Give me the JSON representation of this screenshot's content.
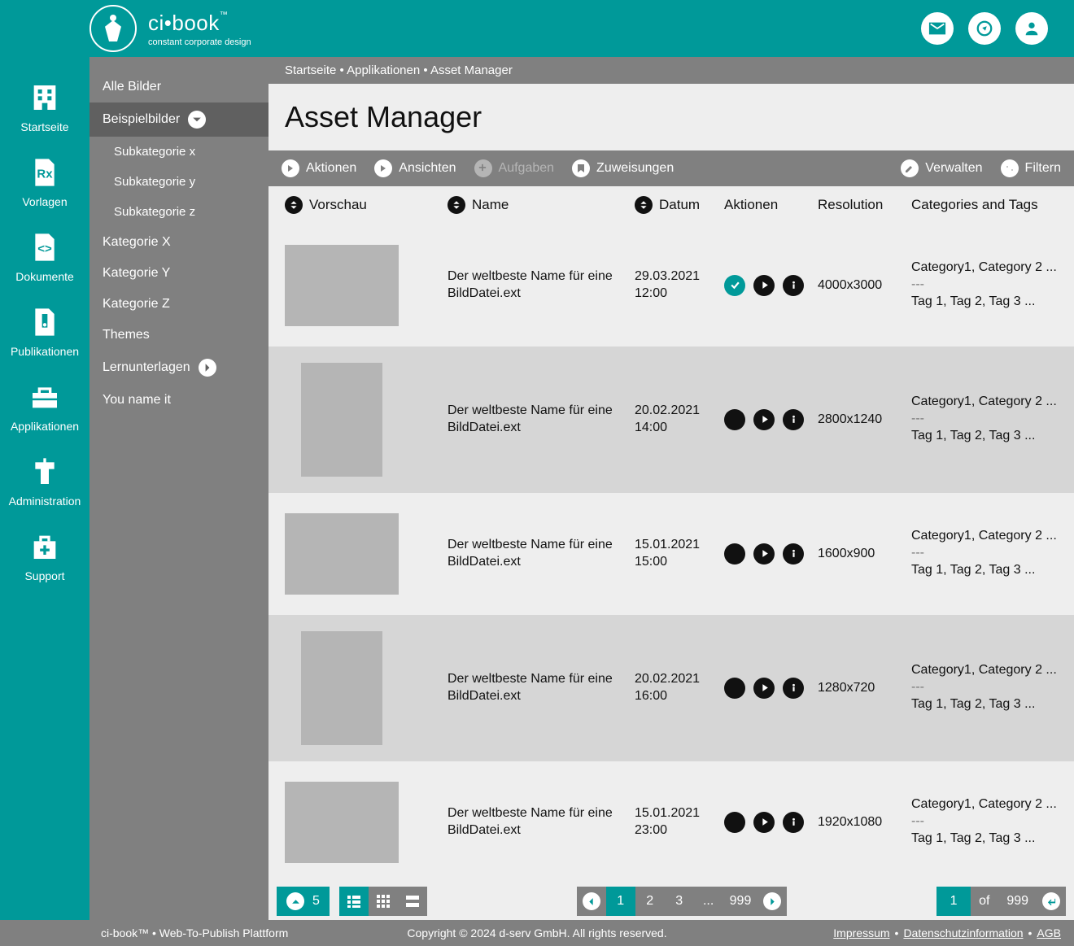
{
  "brand": {
    "name": "ci•book",
    "tm": "™",
    "sub": "constant corporate design"
  },
  "primary_nav": [
    {
      "key": "startseite",
      "label": "Startseite"
    },
    {
      "key": "vorlagen",
      "label": "Vorlagen"
    },
    {
      "key": "dokumente",
      "label": "Dokumente"
    },
    {
      "key": "publikationen",
      "label": "Publikationen"
    },
    {
      "key": "applikationen",
      "label": "Applikationen"
    },
    {
      "key": "administration",
      "label": "Administration"
    },
    {
      "key": "support",
      "label": "Support"
    }
  ],
  "secondary_nav": {
    "items": [
      {
        "label": "Alle Bilder"
      },
      {
        "label": "Beispielbilder",
        "active": true,
        "expand": true
      },
      {
        "label": "Subkategorie x",
        "sub": true
      },
      {
        "label": "Subkategorie y",
        "sub": true
      },
      {
        "label": "Subkategorie z",
        "sub": true
      },
      {
        "label": "Kategorie X"
      },
      {
        "label": "Kategorie Y"
      },
      {
        "label": "Kategorie Z"
      },
      {
        "label": "Themes"
      },
      {
        "label": "Lernunterlagen",
        "expand_right": true
      },
      {
        "label": "You name it"
      }
    ]
  },
  "breadcrumb": "Startseite • Applikationen • Asset Manager",
  "page_title": "Asset Manager",
  "toolbar": {
    "left": [
      {
        "key": "aktionen",
        "label": "Aktionen",
        "icon": "play"
      },
      {
        "key": "ansichten",
        "label": "Ansichten",
        "icon": "play"
      },
      {
        "key": "aufgaben",
        "label": "Aufgaben",
        "icon": "plus",
        "disabled": true
      },
      {
        "key": "zuweisungen",
        "label": "Zuweisungen",
        "icon": "bookmark"
      }
    ],
    "right": [
      {
        "key": "verwalten",
        "label": "Verwalten",
        "icon": "pencil"
      },
      {
        "key": "filtern",
        "label": "Filtern",
        "icon": "swap"
      }
    ]
  },
  "columns": {
    "thumb": "Vorschau",
    "name": "Name",
    "date": "Datum",
    "actions": "Aktionen",
    "resolution": "Resolution",
    "categories": "Categories and Tags"
  },
  "rows": [
    {
      "thumb": "w",
      "name": "Der weltbeste Name für eine BildDatei.ext",
      "date": "29.03.2021 12:00",
      "checked": true,
      "resolution": "4000x3000",
      "categories": "Category1, Category 2 ...",
      "tags": "Tag 1, Tag 2, Tag 3 ..."
    },
    {
      "thumb": "t",
      "name": "Der weltbeste Name für eine BildDatei.ext",
      "date": "20.02.2021 14:00",
      "checked": false,
      "resolution": "2800x1240",
      "categories": "Category1, Category 2 ...",
      "tags": "Tag 1, Tag 2, Tag 3 ..."
    },
    {
      "thumb": "w",
      "name": "Der weltbeste Name für eine BildDatei.ext",
      "date": "15.01.2021 15:00",
      "checked": false,
      "resolution": "1600x900",
      "categories": "Category1, Category 2 ...",
      "tags": "Tag 1, Tag 2, Tag 3 ..."
    },
    {
      "thumb": "t",
      "name": "Der weltbeste Name für eine BildDatei.ext",
      "date": "20.02.2021 16:00",
      "checked": false,
      "resolution": "1280x720",
      "categories": "Category1, Category 2 ...",
      "tags": "Tag 1, Tag 2, Tag 3 ..."
    },
    {
      "thumb": "w",
      "name": "Der weltbeste Name für eine BildDatei.ext",
      "date": "15.01.2021 23:00",
      "checked": false,
      "resolution": "1920x1080",
      "categories": "Category1, Category 2 ...",
      "tags": "Tag 1, Tag 2, Tag 3 ..."
    }
  ],
  "pager": {
    "page_size": "5",
    "pages": [
      "1",
      "2",
      "3",
      "...",
      "999"
    ],
    "current": "1",
    "jump_current": "1",
    "of_label": "of",
    "total": "999"
  },
  "footer": {
    "left": "ci-book™ • Web-To-Publish Plattform",
    "center": "Copyright © 2024 d-serv GmbH. All rights reserved.",
    "links": [
      "Impressum",
      "Datenschutzinformation",
      "AGB"
    ]
  }
}
